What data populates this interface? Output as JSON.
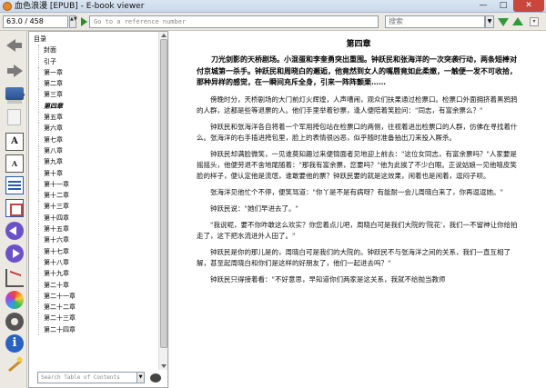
{
  "window": {
    "title": "血色浪漫 [EPUB] - E-book viewer",
    "minimize": "—",
    "maximize": "□",
    "close": "✕"
  },
  "toolbar": {
    "position_value": "63.0 / 458",
    "spin": "▲▼",
    "reference_placeholder": "Go to a reference number",
    "search_value": "搜索",
    "search_drop": "▼",
    "small_btn": "▾"
  },
  "icons": {
    "back": "back-arrow-icon",
    "forward": "forward-arrow-icon",
    "open_book": "open-book-icon",
    "page": "page-icon",
    "font_larger": "A",
    "font_smaller": "A",
    "drop": "▾"
  },
  "toc": {
    "root": "目录",
    "items": [
      "封面",
      "引子",
      "第一章",
      "第二章",
      "第三章",
      "第四章",
      "第五章",
      "第六章",
      "第七章",
      "第八章",
      "第九章",
      "第十章",
      "第十一章",
      "第十二章",
      "第十三章",
      "第十四章",
      "第十五章",
      "第十六章",
      "第十七章",
      "第十八章",
      "第十九章",
      "第二十章",
      "第二十一章",
      "第二十二章",
      "第二十三章",
      "第二十四章"
    ],
    "current_index": 5,
    "search_placeholder": "Search Table of Contents",
    "search_drop": "▼"
  },
  "reader": {
    "chapter_title": "第四章",
    "summary": "刀光剑影的天桥剧场。小混蛋和李奎勇突出重围。钟跃民和张海洋的一次突袭行动，两条短棒对付京城第一杀手。钟跃民和周晓白的邂逅，他竟然到女人的嘴唇竟如此柔嫩，一触便一发不可收拾，那种异样的感觉，在一瞬间充斥全身，引来一阵阵颤栗……",
    "paragraphs": [
      "傍晚时分，天桥剧场的大门前灯火辉煌，人声嘈闹，观众们扶果通过检票口。检票口外面拥挤着黑鸦鸦的人群，这都是些等退票的人。他们手里举着钞票，逢人便陪着笑脸问：\"同志，有富余票么？\"",
      "钟跃民和张海洋各自将着一个军用挎包站在检票口的两侧，往视着进出检票口的人群，仿佛在寻找着什么。张海洋的右手插进挎包里，脸上的表情很凶恶，似乎随时准备抽出刀来投入厮杀。",
      "钟跃民却满脸微笑，一见谁莫知趣过来便锦面者见地迎上前去：\"这位女同志，有富余票吗？\"人家要是摇摇头，他便劳退不舍地尾随着：\"那我有富余票，您要吗？\"他为此挨了不少白眼。正说姑娘一见他嘻皮笑脸的样子，便认定他是流氓，谁敢要他的票？钟跃民要的就是这效果，闲着也是闲着，逗闷子呗。",
      "张海洋见他忙个不停，便笑骂道：\"你丫是不是有病呀？有能耐一会儿周晓白来了，你再逗逗她。\"",
      "钟跃民说：\"她们早进去了。\"",
      "\"我说呢，要不你咋敢这么欢实？你您着点儿吧，周晓白可是我们大院的'院花'，我们一不留神让你给拍走了，这下把水流进外人田了。\"",
      "钟跃民是你的那儿是的，周晓白可是我们的大院的。钟跃民不与张海洋之间的关系，我们一直互相了解，甚至起周晓白和你们是这样的好朋友了，他们一起进去吗？\"",
      "钟跃民只得接着看：\"不好意思，早知道你们两家是这关系，我就不给抛当教师"
    ]
  }
}
